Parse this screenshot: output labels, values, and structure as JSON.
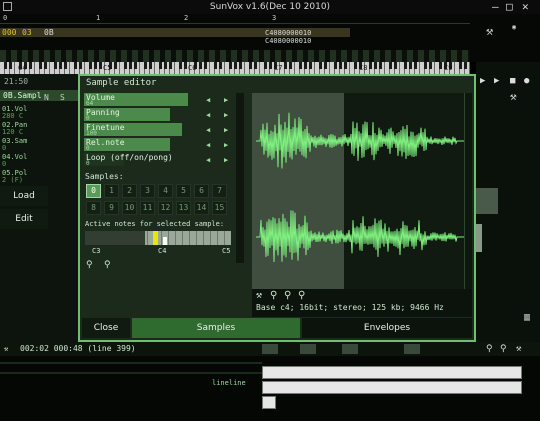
{
  "window": {
    "title": "SunVox v1.6(Dec 10 2010)"
  },
  "pattern_editor": {
    "ruler": [
      "0",
      "1",
      "2",
      "3"
    ],
    "row_num": "000",
    "row_vals": [
      "03",
      "0B"
    ],
    "tracker_cells": [
      "C4080000010",
      "C4080000010"
    ]
  },
  "piano": {
    "octaves": [
      "C4",
      "C5",
      "C6",
      "C7",
      "C8",
      "C9"
    ]
  },
  "left_panel": {
    "clock": "21:50",
    "selected_sample": "0B.Sampl",
    "col_headers": [
      "N",
      "S"
    ],
    "modules": [
      {
        "name": "01.Vol",
        "sub": "280 C"
      },
      {
        "name": "02.Pan",
        "sub": "120 C"
      },
      {
        "name": "03.Sam",
        "sub": "0"
      },
      {
        "name": "04.Vol",
        "sub": "0"
      },
      {
        "name": "05.Pol",
        "sub": "2 (F)"
      }
    ],
    "load_label": "Load",
    "edit_label": "Edit"
  },
  "sample_editor": {
    "title": "Sample editor",
    "fields": [
      {
        "name": "Volume",
        "value": "64"
      },
      {
        "name": "Panning",
        "value": "0"
      },
      {
        "name": "Finetune",
        "value": "100"
      },
      {
        "name": "Rel.note",
        "value": "0"
      },
      {
        "name": "Loop (off/on/pong)",
        "value": "0"
      }
    ],
    "samples_label": "Samples:",
    "sample_slots": [
      "0",
      "1",
      "2",
      "3",
      "4",
      "5",
      "6",
      "7",
      "8",
      "9",
      "10",
      "11",
      "12",
      "13",
      "14",
      "15"
    ],
    "active_notes_label": "Active notes for selected sample:",
    "note_labels": [
      "C3",
      "C4",
      "C5"
    ],
    "info": "Base c4; 16bit; stereo; 125 kb; 9466 Hz",
    "close_label": "Close",
    "samples_tab_label": "Samples",
    "envelopes_tab_label": "Envelopes"
  },
  "timeline": {
    "position": "002:02 000:48 (line 399)",
    "lineline_label": "lineline"
  },
  "colors": {
    "accent": "#6fbf6f",
    "active_tab": "#2f6a2f",
    "field": "#4c8a4c",
    "wave": "#7ff07f",
    "note_marker": "#e8e800"
  }
}
